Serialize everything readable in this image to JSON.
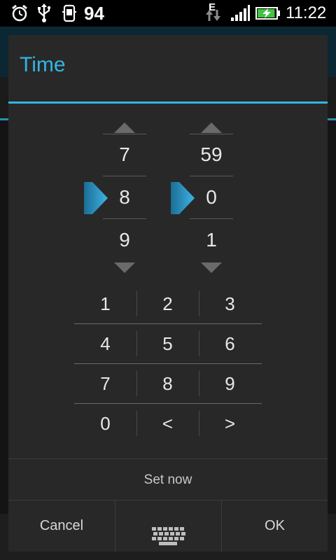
{
  "status_bar": {
    "battery_percent_label": "94",
    "network_type": "E",
    "time": "11:22",
    "icons": [
      "alarm-icon",
      "usb-icon",
      "android-debug-icon",
      "data-arrows-icon",
      "signal-icon",
      "battery-charging-icon"
    ],
    "battery_level_fraction": 0.94
  },
  "dialog": {
    "title": "Time",
    "accent_color": "#33b5e5",
    "hour_picker": {
      "previous": "7",
      "current": "8",
      "next": "9"
    },
    "minute_picker": {
      "previous": "59",
      "current": "0",
      "next": "1"
    },
    "keypad": [
      [
        "1",
        "2",
        "3"
      ],
      [
        "4",
        "5",
        "6"
      ],
      [
        "7",
        "8",
        "9"
      ],
      [
        "0",
        "<",
        ">"
      ]
    ],
    "set_now_label": "Set now",
    "buttons": {
      "cancel": "Cancel",
      "ok": "OK"
    },
    "keyboard_icon": "keyboard-icon"
  }
}
